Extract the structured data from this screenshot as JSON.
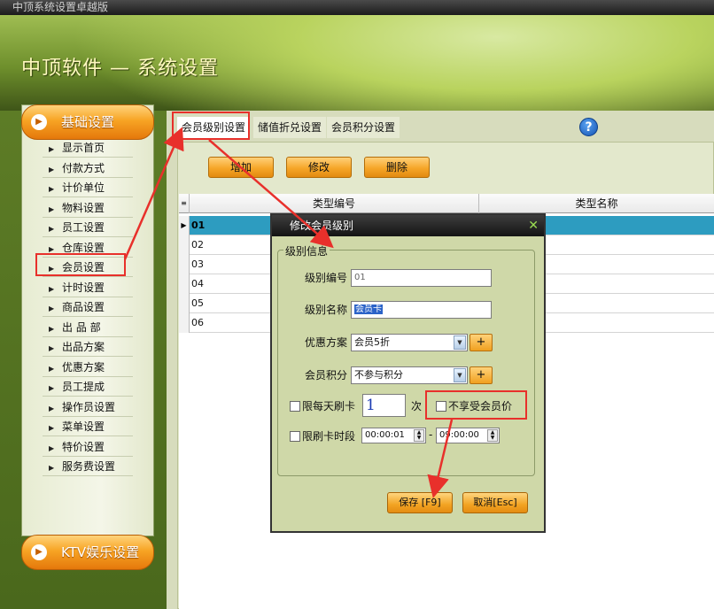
{
  "window": {
    "title": "中顶系统设置卓越版"
  },
  "banner": {
    "title": "中顶软件 — 系统设置"
  },
  "sidebar": {
    "header": "基础设置",
    "items": [
      {
        "label": "显示首页"
      },
      {
        "label": "付款方式"
      },
      {
        "label": "计价单位"
      },
      {
        "label": "物料设置"
      },
      {
        "label": "员工设置"
      },
      {
        "label": "仓库设置"
      },
      {
        "label": "会员设置"
      },
      {
        "label": "计时设置"
      },
      {
        "label": "商品设置"
      },
      {
        "label": "出 品 部"
      },
      {
        "label": "出品方案"
      },
      {
        "label": "优惠方案"
      },
      {
        "label": "员工提成"
      },
      {
        "label": "操作员设置"
      },
      {
        "label": "菜单设置"
      },
      {
        "label": "特价设置"
      },
      {
        "label": "服务费设置"
      }
    ],
    "footer": "KTV娱乐设置"
  },
  "tabs": [
    {
      "label": "会员级别设置"
    },
    {
      "label": "储值折兑设置"
    },
    {
      "label": "会员积分设置"
    }
  ],
  "toolbar": {
    "add": "增加",
    "edit": "修改",
    "delete": "删除"
  },
  "grid": {
    "columns": [
      "类型编号",
      "类型名称"
    ],
    "rows": [
      {
        "code": "01",
        "selected": true
      },
      {
        "code": "02"
      },
      {
        "code": "03"
      },
      {
        "code": "04"
      },
      {
        "code": "05"
      },
      {
        "code": "06"
      }
    ]
  },
  "dialog": {
    "title": "修改会员级别",
    "group": "级别信息",
    "level_code_label": "级别编号",
    "level_code_value": "01",
    "level_name_label": "级别名称",
    "level_name_value": "会员卡",
    "discount_label": "优惠方案",
    "discount_value": "会员5折",
    "points_label": "会员积分",
    "points_value": "不参与积分",
    "daily_limit_label": "限每天刷卡",
    "daily_limit_value": "1",
    "daily_limit_unit": "次",
    "no_member_price_label": "不享受会员价",
    "time_limit_label": "限刷卡时段",
    "time_from": "00:00:01",
    "time_sep": "-",
    "time_to": "09:00:00",
    "save": "保存 [F9]",
    "cancel": "取消[Esc]",
    "plus": "+"
  },
  "colors": {
    "accent_orange": "#f6a628",
    "highlight_red": "#e8302b",
    "selected_row": "#2d9cc0"
  }
}
